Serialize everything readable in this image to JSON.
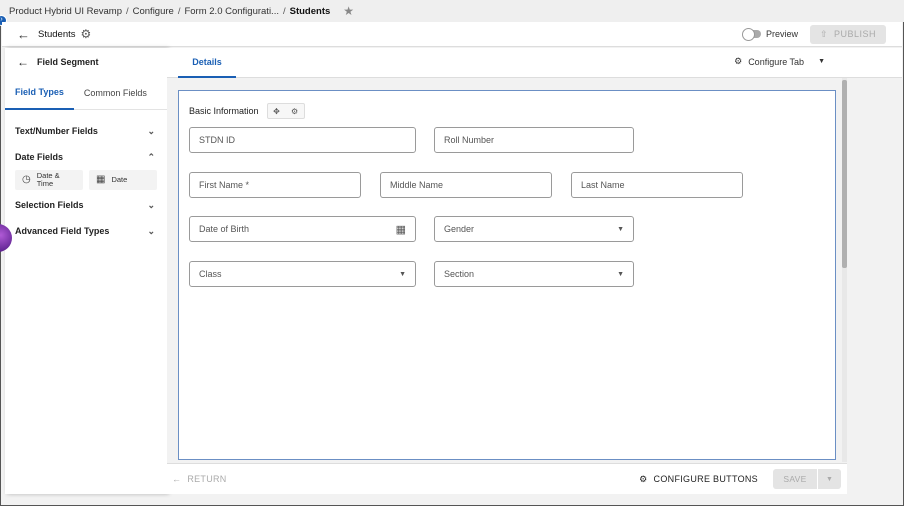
{
  "breadcrumb": {
    "items": [
      "Product Hybrid UI Revamp",
      "Configure",
      "Form 2.0 Configurati..."
    ],
    "current": "Students",
    "separator": "/"
  },
  "header": {
    "title": "Students",
    "preview_label": "Preview",
    "publish_label": "PUBLISH"
  },
  "left_panel": {
    "title": "Field Segment",
    "tabs": [
      "Field Types",
      "Common Fields"
    ],
    "groups": [
      {
        "label": "Text/Number Fields",
        "expanded": false
      },
      {
        "label": "Date Fields",
        "expanded": true
      },
      {
        "label": "Selection Fields",
        "expanded": false
      },
      {
        "label": "Advanced Field Types",
        "expanded": false
      }
    ],
    "date_chips": [
      "Date & Time",
      "Date"
    ]
  },
  "main": {
    "tab": "Details",
    "configure_tab_label": "Configure Tab",
    "section_title": "Basic Information",
    "fields": {
      "stdn_id": "STDN ID",
      "roll_number": "Roll Number",
      "first_name": "First Name *",
      "middle_name": "Middle Name",
      "last_name": "Last Name",
      "date_of_birth": "Date of Birth",
      "gender": "Gender",
      "class": "Class",
      "section": "Section"
    }
  },
  "footer": {
    "return_label": "RETURN",
    "configure_buttons_label": "CONFIGURE BUTTONS",
    "save_label": "SAVE"
  },
  "colors": {
    "accent": "#1a5fb4",
    "canvas_border": "#6b8fc4",
    "disabled": "#e4e4e4"
  }
}
